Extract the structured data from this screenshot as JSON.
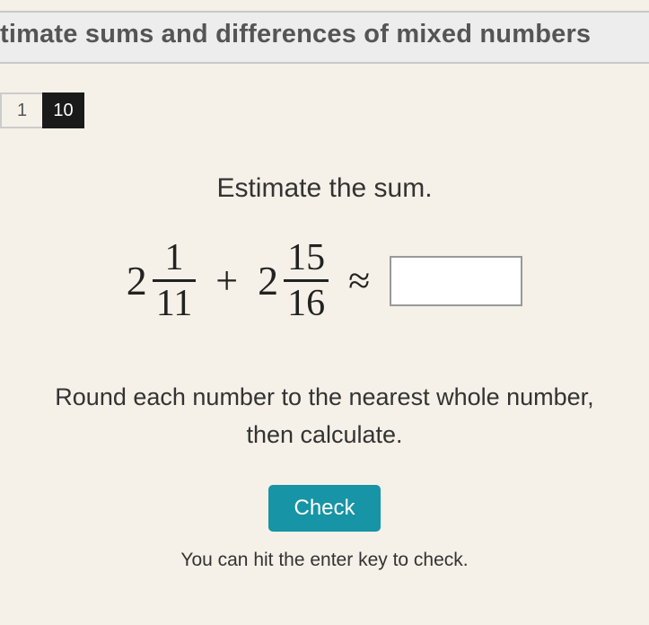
{
  "header": {
    "title": "timate sums and differences of mixed numbers"
  },
  "progress": {
    "current": "1",
    "total": "10"
  },
  "question": {
    "prompt": "Estimate the sum.",
    "term1": {
      "whole": "2",
      "num": "1",
      "den": "11"
    },
    "plus": "+",
    "term2": {
      "whole": "2",
      "num": "15",
      "den": "16"
    },
    "approx": "≈",
    "answer_placeholder": "",
    "instruction_line1": "Round each number to the nearest whole number,",
    "instruction_line2": "then calculate."
  },
  "controls": {
    "check_label": "Check",
    "hint": "You can hit the enter key to check."
  }
}
